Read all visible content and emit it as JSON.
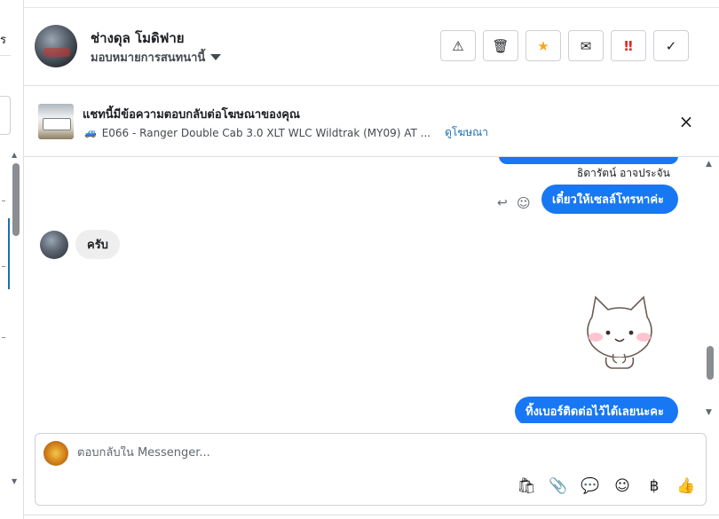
{
  "sidebar": {
    "fragment_text": "ร"
  },
  "header": {
    "contact_name": "ช่างดุล โมดิฟาย",
    "assign_label": "มอบหมายการสนทนานี้",
    "actions": [
      {
        "name": "report-button",
        "icon": "warning-icon",
        "glyph": "⚠"
      },
      {
        "name": "delete-button",
        "icon": "trash-icon",
        "glyph": "🗑"
      },
      {
        "name": "star-button",
        "icon": "star-icon",
        "glyph": "★"
      },
      {
        "name": "mark-unread-button",
        "icon": "envelope-icon",
        "glyph": "✉"
      },
      {
        "name": "spam-button",
        "icon": "double-exclamation-icon",
        "glyph": "‼"
      },
      {
        "name": "done-button",
        "icon": "check-icon",
        "glyph": "✓"
      }
    ]
  },
  "ad_banner": {
    "title": "แชทนี้มีข้อความตอบกลับต่อโฆษณาของคุณ",
    "car_icon": "🚙",
    "listing": "E066 - Ranger Double Cab 3.0 XLT WLC Wildtrak (MY09) AT ...",
    "view_ad_link": "ดูโฆษณา",
    "close_icon": "×"
  },
  "messages": {
    "sender_name": "ธิดารัตน์ อาจประจัน",
    "outgoing_1": "เดี๋ยวให้เซลล์โทรหาค่ะ",
    "incoming_1": "ครับ",
    "outgoing_2": "ทิ้งเบอร์ติดต่อไว้ได้เลยนะคะ",
    "reply_icon": "↩",
    "react_icon": "☺"
  },
  "composer": {
    "placeholder": "ตอบกลับใน Messenger...",
    "tools": [
      {
        "name": "shopping-bag-icon",
        "glyph": "🛍"
      },
      {
        "name": "paperclip-icon",
        "glyph": "📎"
      },
      {
        "name": "saved-reply-icon",
        "glyph": "💬"
      },
      {
        "name": "emoji-icon",
        "glyph": "☺"
      },
      {
        "name": "baht-icon",
        "glyph": "฿"
      },
      {
        "name": "thumbs-up-icon",
        "glyph": "👍"
      }
    ]
  },
  "colors": {
    "accent": "#1877f2",
    "star": "#f5a623",
    "spam": "#e02424",
    "link": "#1a6fb5"
  }
}
